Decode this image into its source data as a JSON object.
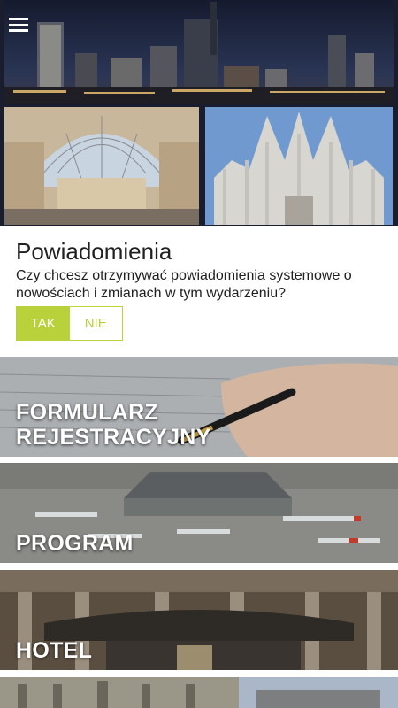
{
  "app": {
    "menu_icon": "hamburger-menu-icon"
  },
  "notifications": {
    "title": "Powiadomienia",
    "text": "Czy chcesz otrzymywać powiadomienia systemowe o nowościach i zmianach w tym wydarzeniu?",
    "yes_label": "TAK",
    "no_label": "NIE",
    "selected": "TAK",
    "accent_color": "#b9d23c"
  },
  "tiles": [
    {
      "label_line1": "FORMULARZ",
      "label_line2": "REJESTRACYJNY"
    },
    {
      "label": "PROGRAM"
    },
    {
      "label": "HOTEL"
    },
    {
      "label": ""
    }
  ]
}
